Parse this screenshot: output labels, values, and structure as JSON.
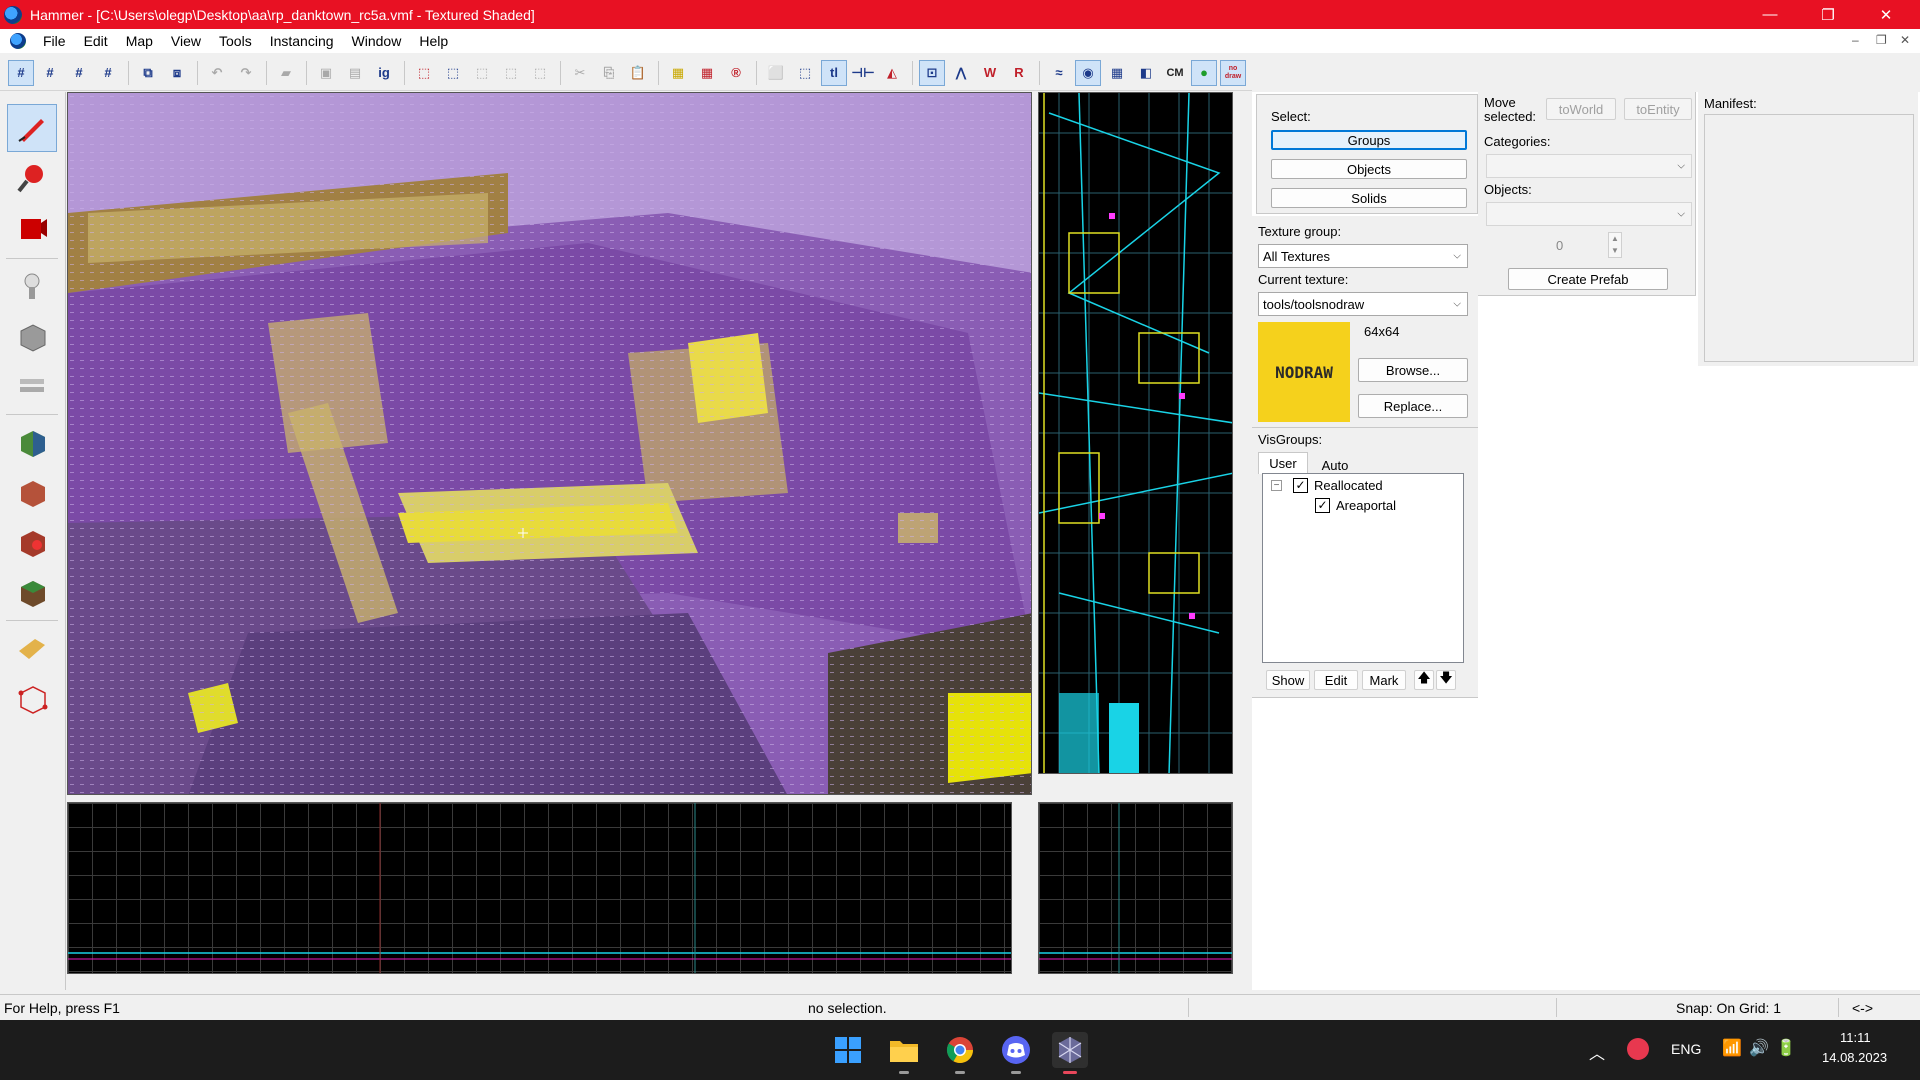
{
  "window": {
    "title": "Hammer - [C:\\Users\\olegp\\Desktop\\aa\\rp_danktown_rc5a.vmf - Textured Shaded]",
    "minimize_glyph": "—",
    "restore_glyph": "❐",
    "close_glyph": "✕"
  },
  "menu": {
    "items": [
      "File",
      "Edit",
      "Map",
      "View",
      "Tools",
      "Instancing",
      "Window",
      "Help"
    ],
    "mdi_min": "–",
    "mdi_restore": "❐",
    "mdi_close": "✕"
  },
  "toolbar": {
    "cm_label": "CM",
    "nodraw_label": "no draw"
  },
  "select_panel": {
    "select_label": "Select:",
    "groups_label": "Groups",
    "objects_label": "Objects",
    "solids_label": "Solids"
  },
  "texture_panel": {
    "group_label": "Texture group:",
    "group_value": "All Textures",
    "current_label": "Current texture:",
    "current_value": "tools/toolsnodraw",
    "size": "64x64",
    "preview_text": "NODRAW",
    "preview_color": "#f5d11c",
    "browse_label": "Browse...",
    "replace_label": "Replace..."
  },
  "visgroups": {
    "label": "VisGroups:",
    "tab_user": "User",
    "tab_auto": "Auto",
    "items": [
      {
        "label": "Reallocated",
        "checked": true
      },
      {
        "label": "Areaportal",
        "checked": true
      }
    ],
    "show_label": "Show",
    "edit_label": "Edit",
    "mark_label": "Mark",
    "up_glyph": "🡅",
    "down_glyph": "🡇"
  },
  "prefab_panel": {
    "move_label": "Move selected:",
    "to_world": "toWorld",
    "to_entity": "toEntity",
    "categories_label": "Categories:",
    "objects_label": "Objects:",
    "count_value": "0",
    "create_prefab": "Create Prefab"
  },
  "manifest": {
    "label": "Manifest:"
  },
  "statusbar": {
    "help": "For Help, press F1",
    "selection": "no selection.",
    "snap": "Snap: On Grid: 1",
    "arrows": "<->"
  },
  "taskbar": {
    "lang": "ENG",
    "time": "11:11",
    "date": "14.08.2023"
  }
}
